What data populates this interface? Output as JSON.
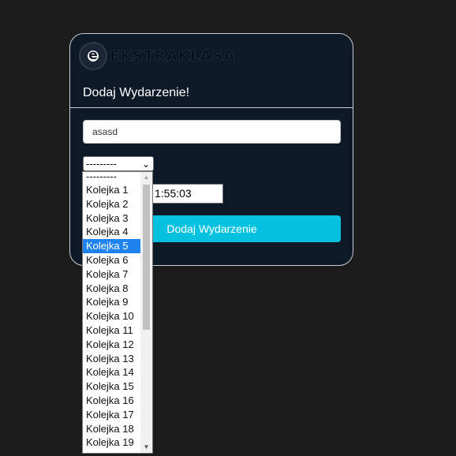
{
  "brand": {
    "badge_letter": "e",
    "name": "EKSTRAKLASA"
  },
  "form": {
    "title": "Dodaj Wydarzenie!",
    "name_value": "asasd",
    "select_selected": "---------",
    "time_visible": "1:55:03",
    "submit_label": "Dodaj Wydarzenie"
  },
  "dropdown": {
    "options": [
      "---------",
      "Kolejka 1",
      "Kolejka 2",
      "Kolejka 3",
      "Kolejka 4",
      "Kolejka 5",
      "Kolejka 6",
      "Kolejka 7",
      "Kolejka 8",
      "Kolejka 9",
      "Kolejka 10",
      "Kolejka 11",
      "Kolejka 12",
      "Kolejka 13",
      "Kolejka 14",
      "Kolejka 15",
      "Kolejka 16",
      "Kolejka 17",
      "Kolejka 18",
      "Kolejka 19"
    ],
    "highlighted": "Kolejka 5"
  },
  "colors": {
    "card_bg": "#0e1928",
    "accent": "#06c2e0",
    "highlight": "#1e82f0"
  }
}
